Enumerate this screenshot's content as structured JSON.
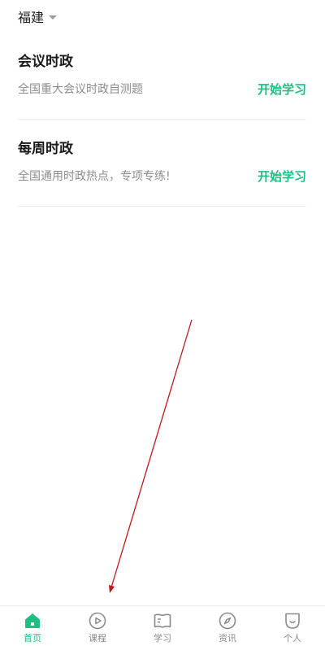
{
  "region": {
    "label": "福建"
  },
  "cards": [
    {
      "title": "会议时政",
      "description": "全国重大会议时政自测题",
      "action": "开始学习"
    },
    {
      "title": "每周时政",
      "description": "全国通用时政热点，专项专练!",
      "action": "开始学习"
    }
  ],
  "tabs": [
    {
      "label": "首页",
      "icon": "home-icon",
      "active": true
    },
    {
      "label": "课程",
      "icon": "play-circle-icon",
      "active": false
    },
    {
      "label": "学习",
      "icon": "open-book-icon",
      "active": false
    },
    {
      "label": "资讯",
      "icon": "compass-icon",
      "active": false
    },
    {
      "label": "个人",
      "icon": "profile-icon",
      "active": false
    }
  ],
  "colors": {
    "accent": "#1ebe82",
    "annotation_arrow": "#c0171b"
  }
}
